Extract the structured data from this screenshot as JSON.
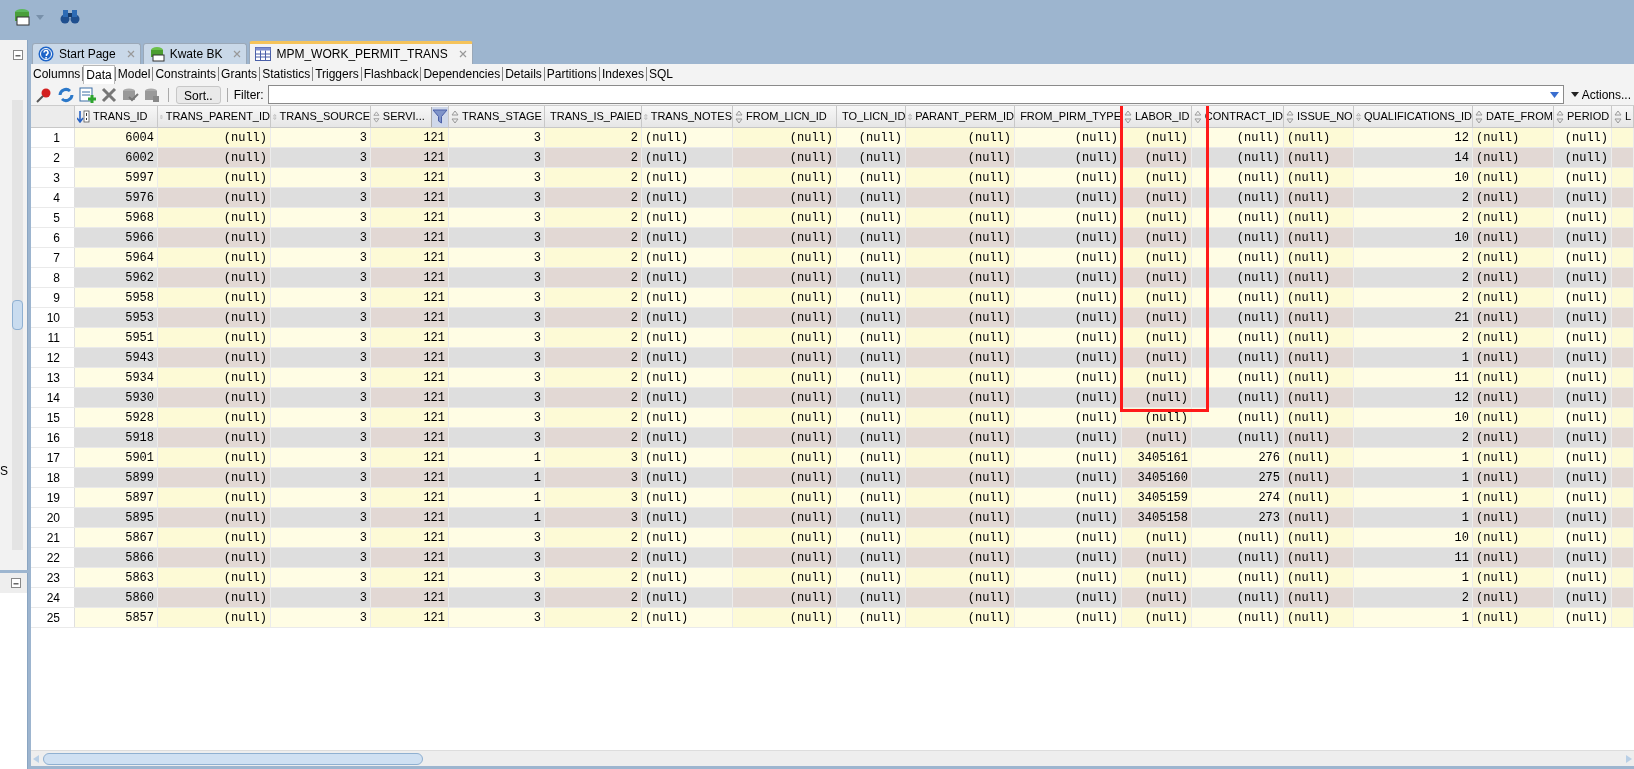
{
  "editor_tabs": [
    {
      "label": "Start Page",
      "selected": false,
      "kind": "help"
    },
    {
      "label": "Kwate BK",
      "selected": false,
      "kind": "connection"
    },
    {
      "label": "MPM_WORK_PERMIT_TRANS",
      "selected": true,
      "kind": "table"
    }
  ],
  "sub_tabs": [
    {
      "label": "Columns",
      "selected": false
    },
    {
      "label": "Data",
      "selected": true
    },
    {
      "label": "Model",
      "selected": false
    },
    {
      "label": "Constraints",
      "selected": false
    },
    {
      "label": "Grants",
      "selected": false
    },
    {
      "label": "Statistics",
      "selected": false
    },
    {
      "label": "Triggers",
      "selected": false
    },
    {
      "label": "Flashback",
      "selected": false
    },
    {
      "label": "Dependencies",
      "selected": false
    },
    {
      "label": "Details",
      "selected": false
    },
    {
      "label": "Partitions",
      "selected": false
    },
    {
      "label": "Indexes",
      "selected": false
    },
    {
      "label": "SQL",
      "selected": false
    }
  ],
  "grid_toolbar": {
    "sort_button": "Sort..",
    "filter_label": "Filter:",
    "actions_button": "Actions..."
  },
  "left_panel": {
    "text": "S"
  },
  "columns": [
    {
      "header": "TRANS_ID",
      "left_aligned": false,
      "kind": "sorted"
    },
    {
      "header": "TRANS_PARENT_ID",
      "left_aligned": false,
      "kind": "plain"
    },
    {
      "header": "TRANS_SOURCE",
      "left_aligned": false,
      "kind": "plain"
    },
    {
      "header": "SERVI...",
      "left_aligned": false,
      "kind": "filtered"
    },
    {
      "header": "TRANS_STAGE",
      "left_aligned": false,
      "kind": "plain"
    },
    {
      "header": "TRANS_IS_PAIED",
      "left_aligned": false,
      "kind": "plain"
    },
    {
      "header": "TRANS_NOTES",
      "left_aligned": true,
      "kind": "plain"
    },
    {
      "header": "FROM_LICN_ID",
      "left_aligned": false,
      "kind": "plain"
    },
    {
      "header": "TO_LICN_ID",
      "left_aligned": false,
      "kind": "plain"
    },
    {
      "header": "PARANT_PERM_ID",
      "left_aligned": false,
      "kind": "plain"
    },
    {
      "header": "FROM_PIRM_TYPE",
      "left_aligned": false,
      "kind": "plain"
    },
    {
      "header": "LABOR_ID",
      "left_aligned": false,
      "kind": "plain"
    },
    {
      "header": "CONTRACT_ID",
      "left_aligned": false,
      "kind": "plain"
    },
    {
      "header": "ISSUE_NO",
      "left_aligned": true,
      "kind": "plain"
    },
    {
      "header": "QUALIFICATIONS_ID",
      "left_aligned": false,
      "kind": "plain"
    },
    {
      "header": "DATE_FROM",
      "left_aligned": true,
      "kind": "plain"
    },
    {
      "header": "PERIOD",
      "left_aligned": false,
      "kind": "plain"
    },
    {
      "header": "L",
      "kind": "plain"
    }
  ],
  "rows": [
    {
      "num": "1",
      "cells": [
        "6004",
        "(null)",
        "3",
        "121",
        "3",
        "2",
        "(null)",
        "(null)",
        "(null)",
        "(null)",
        "(null)",
        "(null)",
        "(null)",
        "(null)",
        "12",
        "(null)",
        "(null)"
      ]
    },
    {
      "num": "2",
      "cells": [
        "6002",
        "(null)",
        "3",
        "121",
        "3",
        "2",
        "(null)",
        "(null)",
        "(null)",
        "(null)",
        "(null)",
        "(null)",
        "(null)",
        "(null)",
        "14",
        "(null)",
        "(null)"
      ]
    },
    {
      "num": "3",
      "cells": [
        "5997",
        "(null)",
        "3",
        "121",
        "3",
        "2",
        "(null)",
        "(null)",
        "(null)",
        "(null)",
        "(null)",
        "(null)",
        "(null)",
        "(null)",
        "10",
        "(null)",
        "(null)"
      ]
    },
    {
      "num": "4",
      "cells": [
        "5976",
        "(null)",
        "3",
        "121",
        "3",
        "2",
        "(null)",
        "(null)",
        "(null)",
        "(null)",
        "(null)",
        "(null)",
        "(null)",
        "(null)",
        "2",
        "(null)",
        "(null)"
      ]
    },
    {
      "num": "5",
      "cells": [
        "5968",
        "(null)",
        "3",
        "121",
        "3",
        "2",
        "(null)",
        "(null)",
        "(null)",
        "(null)",
        "(null)",
        "(null)",
        "(null)",
        "(null)",
        "2",
        "(null)",
        "(null)"
      ]
    },
    {
      "num": "6",
      "cells": [
        "5966",
        "(null)",
        "3",
        "121",
        "3",
        "2",
        "(null)",
        "(null)",
        "(null)",
        "(null)",
        "(null)",
        "(null)",
        "(null)",
        "(null)",
        "10",
        "(null)",
        "(null)"
      ]
    },
    {
      "num": "7",
      "cells": [
        "5964",
        "(null)",
        "3",
        "121",
        "3",
        "2",
        "(null)",
        "(null)",
        "(null)",
        "(null)",
        "(null)",
        "(null)",
        "(null)",
        "(null)",
        "2",
        "(null)",
        "(null)"
      ]
    },
    {
      "num": "8",
      "cells": [
        "5962",
        "(null)",
        "3",
        "121",
        "3",
        "2",
        "(null)",
        "(null)",
        "(null)",
        "(null)",
        "(null)",
        "(null)",
        "(null)",
        "(null)",
        "2",
        "(null)",
        "(null)"
      ]
    },
    {
      "num": "9",
      "cells": [
        "5958",
        "(null)",
        "3",
        "121",
        "3",
        "2",
        "(null)",
        "(null)",
        "(null)",
        "(null)",
        "(null)",
        "(null)",
        "(null)",
        "(null)",
        "2",
        "(null)",
        "(null)"
      ]
    },
    {
      "num": "10",
      "cells": [
        "5953",
        "(null)",
        "3",
        "121",
        "3",
        "2",
        "(null)",
        "(null)",
        "(null)",
        "(null)",
        "(null)",
        "(null)",
        "(null)",
        "(null)",
        "21",
        "(null)",
        "(null)"
      ]
    },
    {
      "num": "11",
      "cells": [
        "5951",
        "(null)",
        "3",
        "121",
        "3",
        "2",
        "(null)",
        "(null)",
        "(null)",
        "(null)",
        "(null)",
        "(null)",
        "(null)",
        "(null)",
        "2",
        "(null)",
        "(null)"
      ]
    },
    {
      "num": "12",
      "cells": [
        "5943",
        "(null)",
        "3",
        "121",
        "3",
        "2",
        "(null)",
        "(null)",
        "(null)",
        "(null)",
        "(null)",
        "(null)",
        "(null)",
        "(null)",
        "1",
        "(null)",
        "(null)"
      ]
    },
    {
      "num": "13",
      "cells": [
        "5934",
        "(null)",
        "3",
        "121",
        "3",
        "2",
        "(null)",
        "(null)",
        "(null)",
        "(null)",
        "(null)",
        "(null)",
        "(null)",
        "(null)",
        "11",
        "(null)",
        "(null)"
      ]
    },
    {
      "num": "14",
      "cells": [
        "5930",
        "(null)",
        "3",
        "121",
        "3",
        "2",
        "(null)",
        "(null)",
        "(null)",
        "(null)",
        "(null)",
        "(null)",
        "(null)",
        "(null)",
        "12",
        "(null)",
        "(null)"
      ]
    },
    {
      "num": "15",
      "cells": [
        "5928",
        "(null)",
        "3",
        "121",
        "3",
        "2",
        "(null)",
        "(null)",
        "(null)",
        "(null)",
        "(null)",
        "(null)",
        "(null)",
        "(null)",
        "10",
        "(null)",
        "(null)"
      ]
    },
    {
      "num": "16",
      "cells": [
        "5918",
        "(null)",
        "3",
        "121",
        "3",
        "2",
        "(null)",
        "(null)",
        "(null)",
        "(null)",
        "(null)",
        "(null)",
        "(null)",
        "(null)",
        "2",
        "(null)",
        "(null)"
      ]
    },
    {
      "num": "17",
      "cells": [
        "5901",
        "(null)",
        "3",
        "121",
        "1",
        "3",
        "(null)",
        "(null)",
        "(null)",
        "(null)",
        "(null)",
        "3405161",
        "276",
        "(null)",
        "1",
        "(null)",
        "(null)"
      ]
    },
    {
      "num": "18",
      "cells": [
        "5899",
        "(null)",
        "3",
        "121",
        "1",
        "3",
        "(null)",
        "(null)",
        "(null)",
        "(null)",
        "(null)",
        "3405160",
        "275",
        "(null)",
        "1",
        "(null)",
        "(null)"
      ]
    },
    {
      "num": "19",
      "cells": [
        "5897",
        "(null)",
        "3",
        "121",
        "1",
        "3",
        "(null)",
        "(null)",
        "(null)",
        "(null)",
        "(null)",
        "3405159",
        "274",
        "(null)",
        "1",
        "(null)",
        "(null)"
      ]
    },
    {
      "num": "20",
      "cells": [
        "5895",
        "(null)",
        "3",
        "121",
        "1",
        "3",
        "(null)",
        "(null)",
        "(null)",
        "(null)",
        "(null)",
        "3405158",
        "273",
        "(null)",
        "1",
        "(null)",
        "(null)"
      ]
    },
    {
      "num": "21",
      "cells": [
        "5867",
        "(null)",
        "3",
        "121",
        "3",
        "2",
        "(null)",
        "(null)",
        "(null)",
        "(null)",
        "(null)",
        "(null)",
        "(null)",
        "(null)",
        "10",
        "(null)",
        "(null)"
      ]
    },
    {
      "num": "22",
      "cells": [
        "5866",
        "(null)",
        "3",
        "121",
        "3",
        "2",
        "(null)",
        "(null)",
        "(null)",
        "(null)",
        "(null)",
        "(null)",
        "(null)",
        "(null)",
        "11",
        "(null)",
        "(null)"
      ]
    },
    {
      "num": "23",
      "cells": [
        "5863",
        "(null)",
        "3",
        "121",
        "3",
        "2",
        "(null)",
        "(null)",
        "(null)",
        "(null)",
        "(null)",
        "(null)",
        "(null)",
        "(null)",
        "1",
        "(null)",
        "(null)"
      ]
    },
    {
      "num": "24",
      "cells": [
        "5860",
        "(null)",
        "3",
        "121",
        "3",
        "2",
        "(null)",
        "(null)",
        "(null)",
        "(null)",
        "(null)",
        "(null)",
        "(null)",
        "(null)",
        "2",
        "(null)",
        "(null)"
      ]
    },
    {
      "num": "25",
      "cells": [
        "5857",
        "(null)",
        "3",
        "121",
        "3",
        "2",
        "(null)",
        "(null)",
        "(null)",
        "(null)",
        "(null)",
        "(null)",
        "(null)",
        "(null)",
        "1",
        "(null)",
        "(null)"
      ]
    }
  ]
}
